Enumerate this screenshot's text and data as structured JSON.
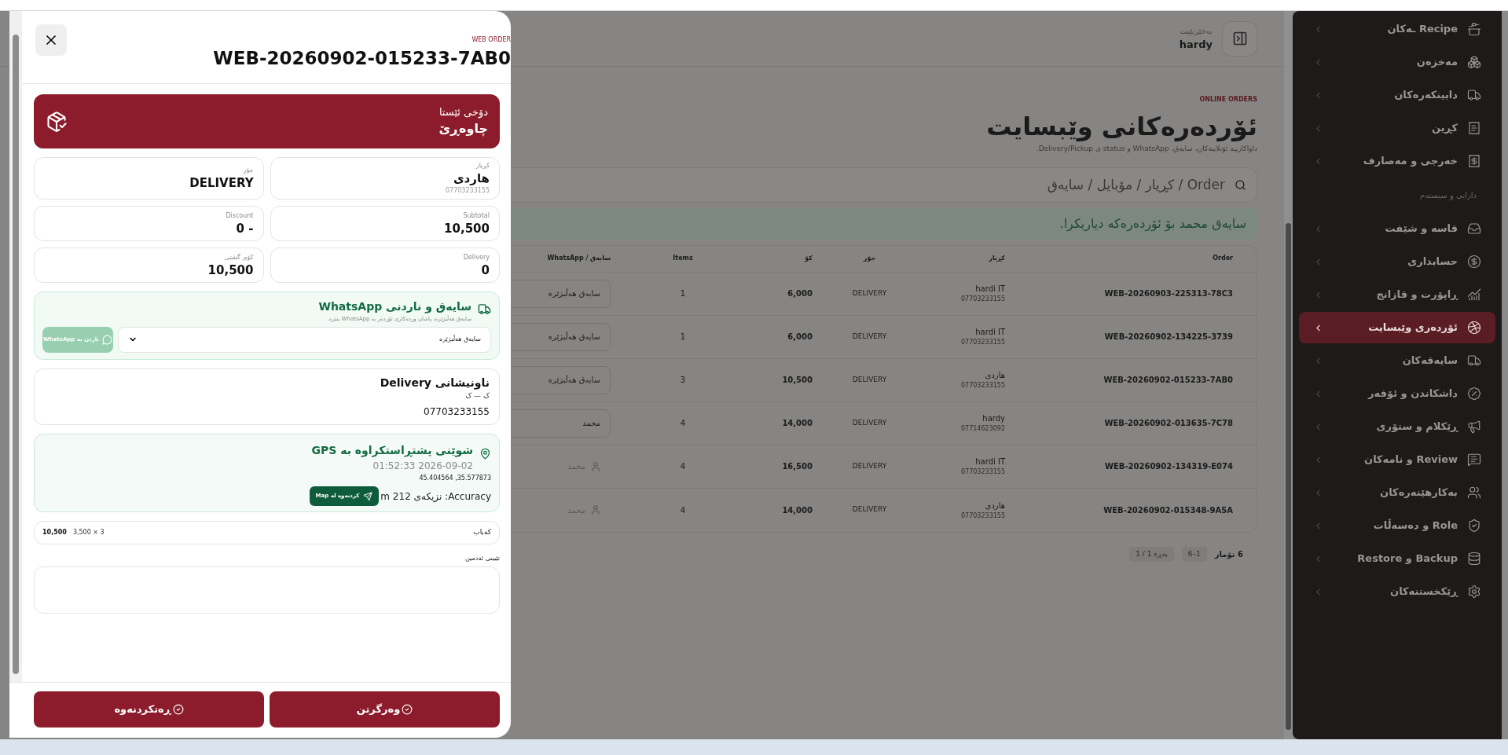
{
  "dialog": {
    "eyebrow": "WEB ORDER",
    "title": "WEB-20260902-015233-7AB0",
    "status": {
      "label": "دۆخی ئێستا",
      "value": "چاوەڕێ"
    },
    "fields": [
      {
        "label": "کڕیار",
        "value": "هاردی",
        "sub": "07703233155"
      },
      {
        "label": "جۆر",
        "value": "DELIVERY"
      },
      {
        "label": "Subtotal",
        "value": "10,500"
      },
      {
        "label": "Discount",
        "value": "0 -"
      },
      {
        "label": "Delivery",
        "value": "0"
      },
      {
        "label": "کۆی گشتی",
        "value": "10,500"
      }
    ],
    "whatsapp": {
      "title": "سایەق و ناردنی WhatsApp",
      "hint": "سایەق هەڵبژێرە، پاشان وردەکاری ئۆردەر بە WhatsApp بنێرە.",
      "select_value": "سایەق هەڵبژێرە",
      "send_label": "ناردن بە WhatsApp",
      "send_disabled": true
    },
    "address": {
      "title": "ناونیشانی Delivery",
      "line": "ک — ک",
      "phone": "07703233155"
    },
    "gps": {
      "title": "شوێنی پشتڕاستکراوە بە GPS",
      "time": "2026-09-02 01:52:33",
      "coords": "35.577873, 45.404564",
      "accuracy": "Accuracy: نزیکەی 212 m",
      "map_label": "کردنەوە لە Map"
    },
    "items": [
      {
        "name": "کەباب",
        "qty": "3 × 3,500",
        "total": "10,500"
      }
    ],
    "note": {
      "label": "تێبینی ئەدمین"
    },
    "actions": [
      {
        "label": "وەرگرتن"
      },
      {
        "label": "ڕەتکردنەوە"
      }
    ]
  },
  "header": {
    "greeting": "بەخێربێیت",
    "user": "hardy"
  },
  "page": {
    "eyebrow": "ONLINE ORDERS",
    "title": "ئۆردەرەکانی وێبسایت",
    "subtitle": "داواکارییە ئۆنلاینەکان، سایەق، WhatsApp و status ی Delivery/Pickup.",
    "search_placeholder": "Order / کڕیار / مۆبایل / سایەق",
    "alert": "سایەق محمد بۆ ئۆردەرەکە دیاریکرا."
  },
  "table": {
    "columns": [
      "Order",
      "کڕیار",
      "جۆر",
      "کۆ",
      "Items",
      "سایەق / WhatsApp"
    ],
    "rows": [
      {
        "order": "WEB-20260903-225313-78C3",
        "customer": "hardi IT",
        "phone": "07703233155",
        "type": "DELIVERY",
        "total": "6,000",
        "items": "1",
        "driver": {
          "kind": "select",
          "text": "سایەق هەڵبژێرە"
        }
      },
      {
        "order": "WEB-20260902-134225-3739",
        "customer": "hardi IT",
        "phone": "07703233155",
        "type": "DELIVERY",
        "total": "6,000",
        "items": "1",
        "driver": {
          "kind": "select",
          "text": "سایەق هەڵبژێرە"
        }
      },
      {
        "order": "WEB-20260902-015233-7AB0",
        "customer": "هاردی",
        "phone": "07703233155",
        "type": "DELIVERY",
        "total": "10,500",
        "items": "3",
        "driver": {
          "kind": "select",
          "text": "سایەق هەڵبژێرە"
        }
      },
      {
        "order": "WEB-20260902-013635-7C78",
        "customer": "hardy",
        "phone": "07714623092",
        "type": "DELIVERY",
        "total": "14,000",
        "items": "4",
        "driver": {
          "kind": "select",
          "text": "محمد"
        }
      },
      {
        "order": "WEB-20260902-134319-E074",
        "customer": "hardi IT",
        "phone": "07703233155",
        "type": "DELIVERY",
        "total": "16,500",
        "items": "4",
        "driver": {
          "kind": "assigned",
          "text": "محمد"
        }
      },
      {
        "order": "WEB-20260902-015348-9A5A",
        "customer": "هاردی",
        "phone": "07703233155",
        "type": "DELIVERY",
        "total": "14,000",
        "items": "4",
        "driver": {
          "kind": "assigned",
          "text": "محمد"
        }
      }
    ],
    "footer": {
      "count": "6 تۆمار",
      "range": "1–6",
      "page": "پەڕە 1 / 1"
    }
  },
  "sidebar": {
    "items": [
      {
        "kind": "item",
        "label": "Recipe ـەکان",
        "selected": false
      },
      {
        "kind": "item",
        "label": "مەخزەن",
        "selected": false
      },
      {
        "kind": "item",
        "label": "دابینکەرەکان",
        "selected": false
      },
      {
        "kind": "item",
        "label": "کڕین",
        "selected": false
      },
      {
        "kind": "item",
        "label": "خەرجی و مەصارف",
        "selected": false
      },
      {
        "kind": "section",
        "label": "دارایی و سیستەم"
      },
      {
        "kind": "item",
        "label": "قاسە و شێفت",
        "selected": false
      },
      {
        "kind": "item",
        "label": "حسابداری",
        "selected": false
      },
      {
        "kind": "item",
        "label": "ڕاپۆرت و قازانج",
        "selected": false
      },
      {
        "kind": "item",
        "label": "ئۆردەری وێبسایت",
        "selected": true
      },
      {
        "kind": "item",
        "label": "سایەقەکان",
        "selected": false
      },
      {
        "kind": "item",
        "label": "داشکاندن و ئۆفەر",
        "selected": false
      },
      {
        "kind": "item",
        "label": "ڕێکلام و ستۆری",
        "selected": false
      },
      {
        "kind": "item",
        "label": "Review و نامەکان",
        "selected": false
      },
      {
        "kind": "item",
        "label": "بەکارهێنەرەکان",
        "selected": false
      },
      {
        "kind": "item",
        "label": "Role و دەسەڵات",
        "selected": false
      },
      {
        "kind": "item",
        "label": "Backup و Restore",
        "selected": false
      },
      {
        "kind": "item",
        "label": "ڕێکخستنەکان",
        "selected": false
      }
    ]
  }
}
